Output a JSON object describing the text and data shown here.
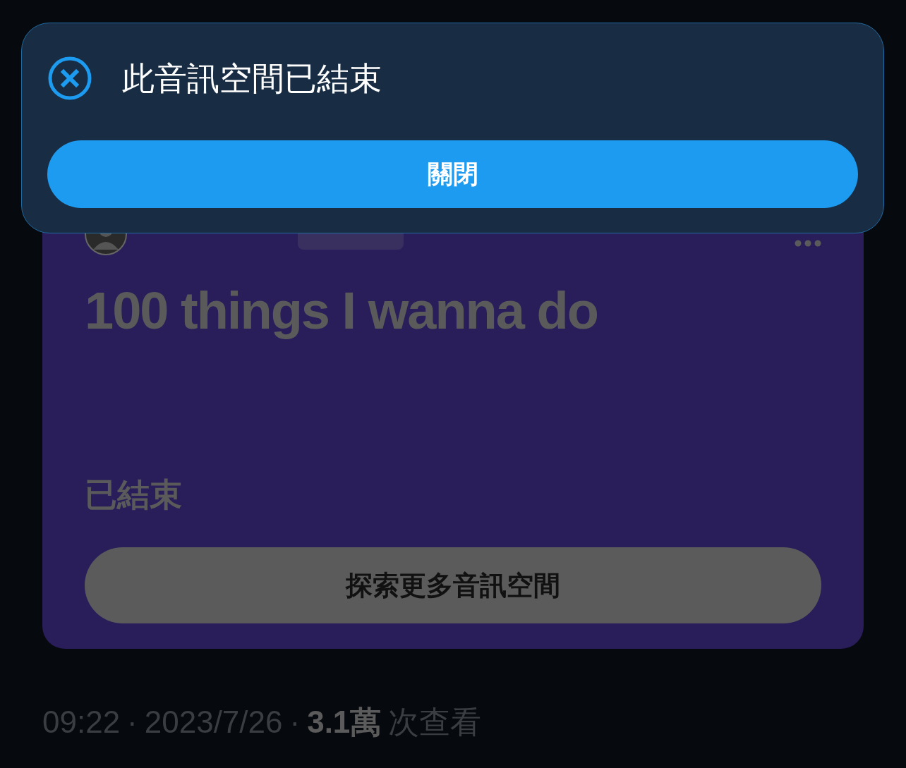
{
  "space_card": {
    "title": "100 things I wanna do",
    "status": "已結束",
    "explore_button": "探索更多音訊空間"
  },
  "meta": {
    "time": "09:22",
    "separator_1": "·",
    "date": "2023/7/26",
    "separator_2": "·",
    "views_count": "3.1萬",
    "views_label": "次查看"
  },
  "toast": {
    "message": "此音訊空間已結束",
    "close_button": "關閉"
  }
}
